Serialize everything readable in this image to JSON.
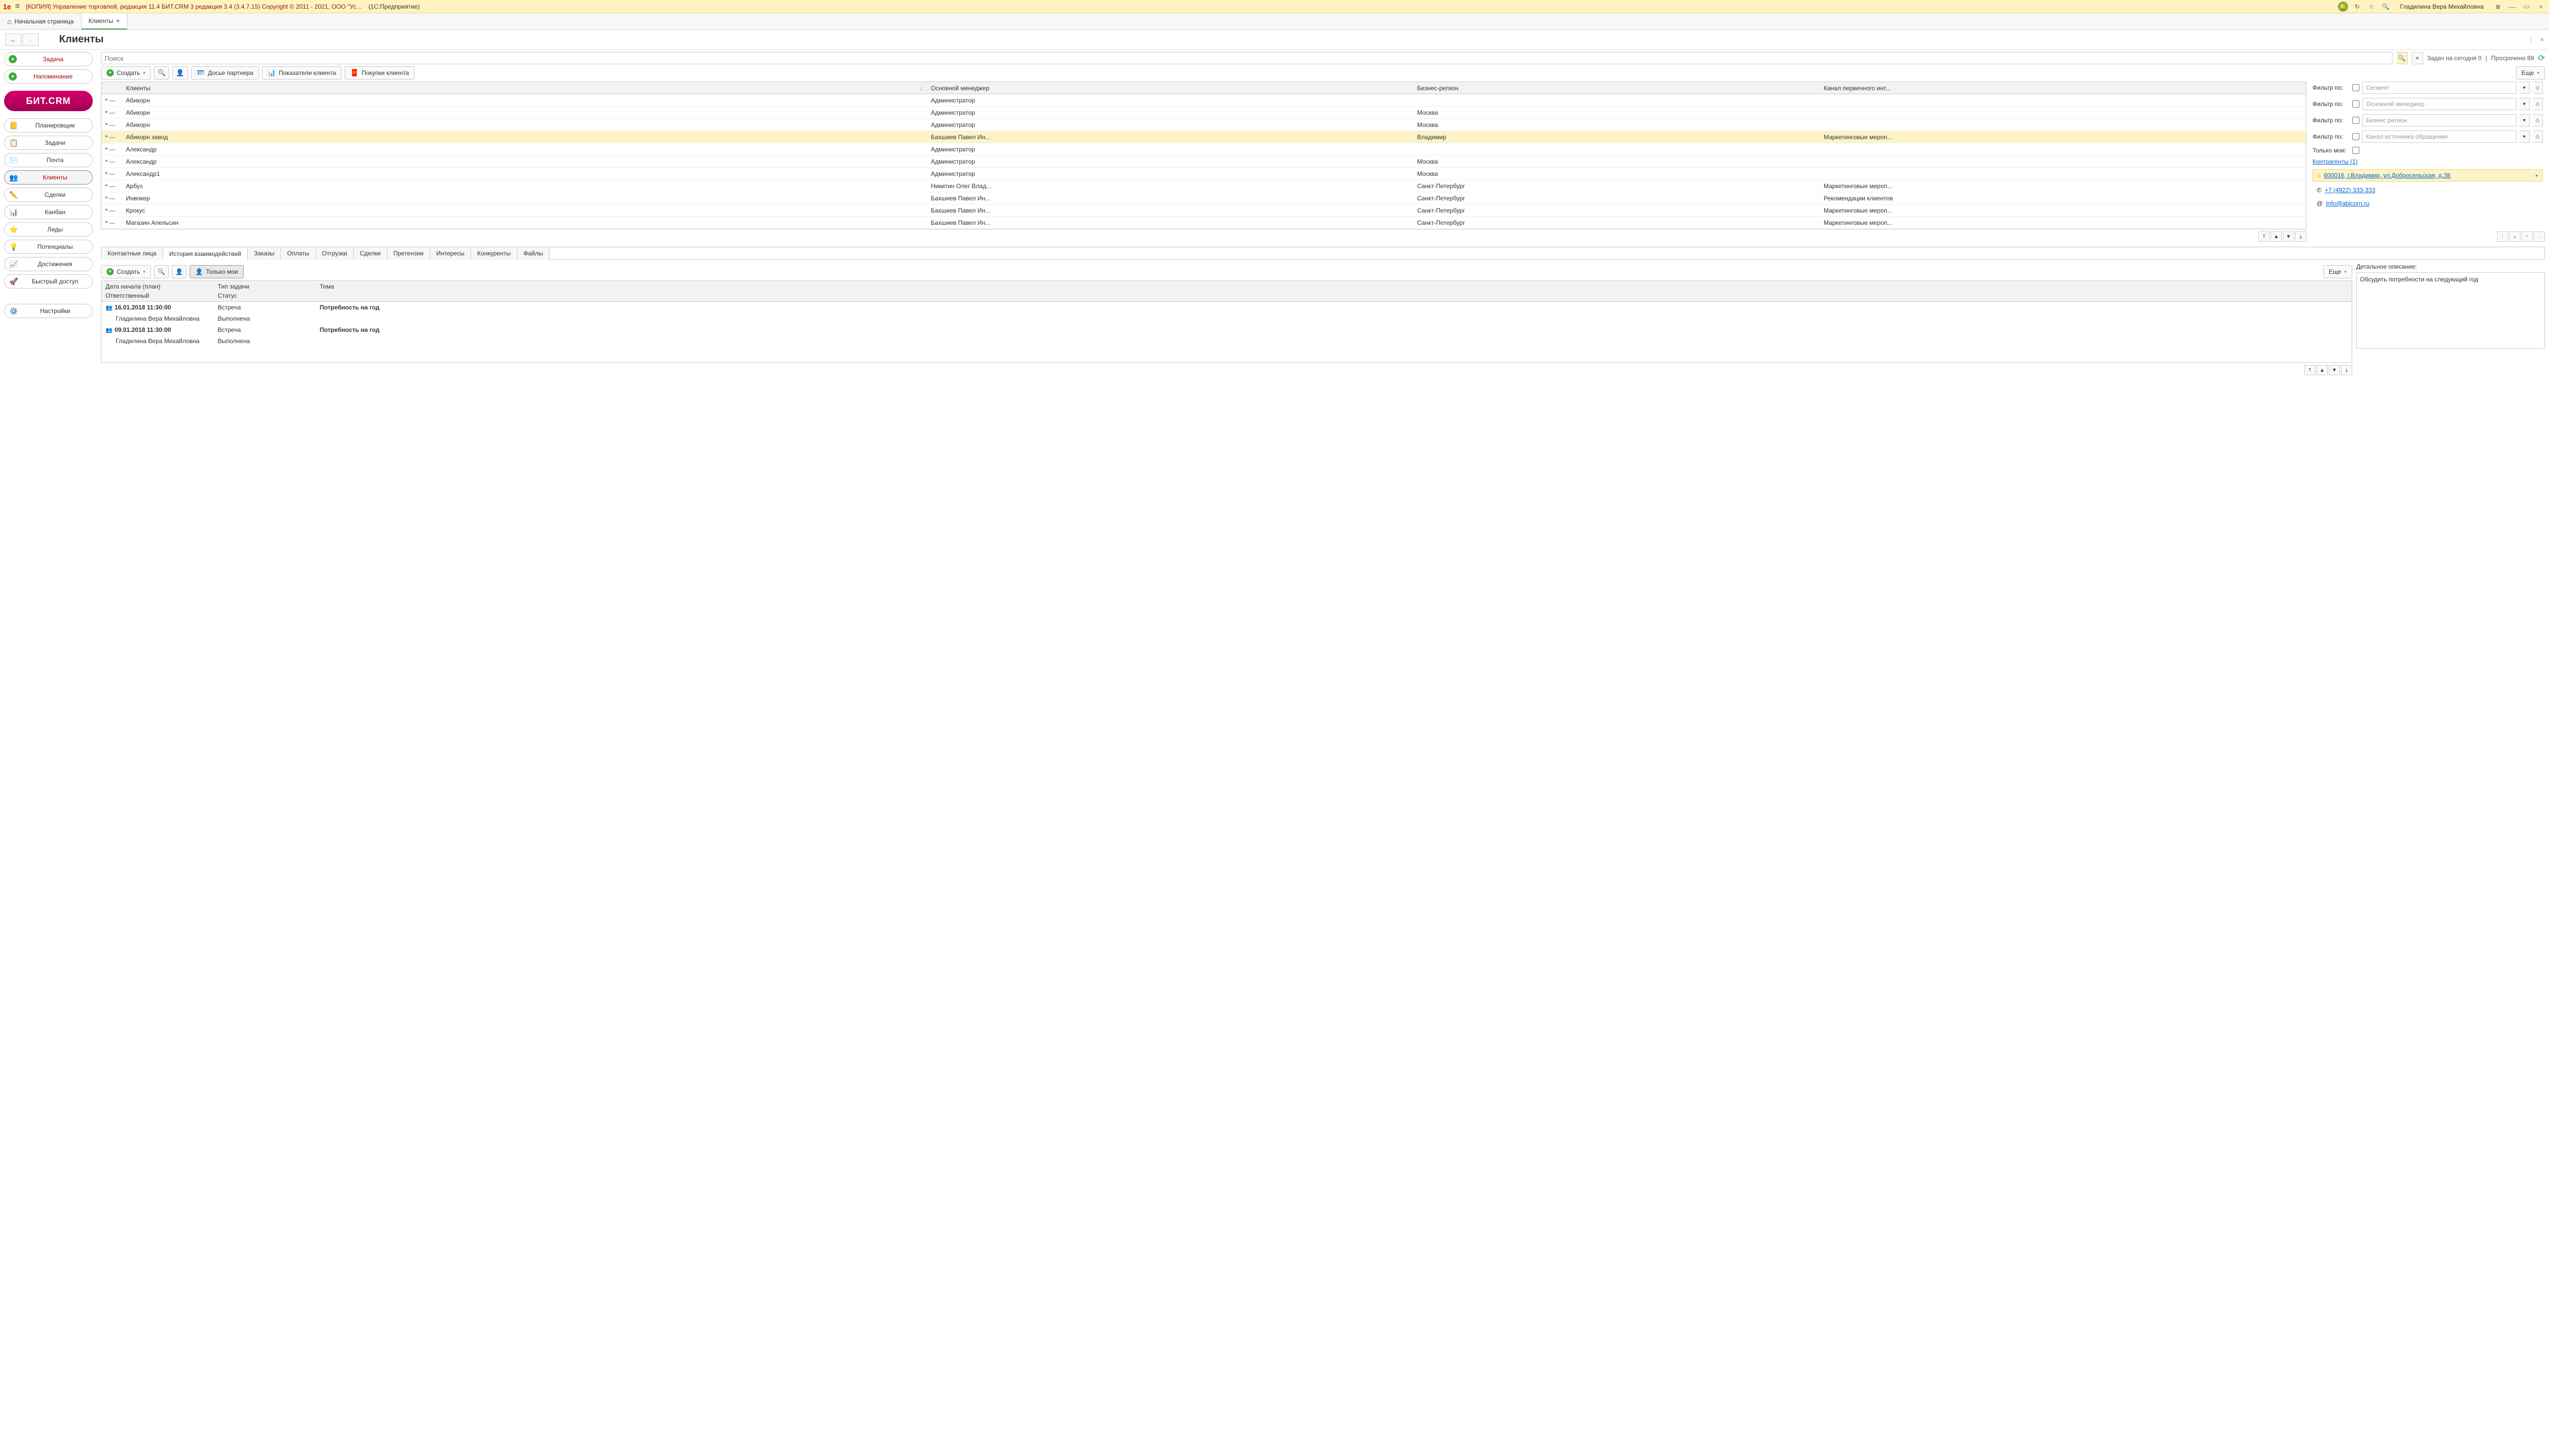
{
  "titlebar": {
    "title": "[КОПИЯ] Управление торговлей, редакция 11.4 БИТ.CRM 3 редакция 3.4 (3.4.7.15) Copyright © 2011 - 2021, ООО \"Ус...",
    "app": "(1С:Предприятие)",
    "user": "Гладилина Вера Михайловна"
  },
  "tabs": {
    "home": "Начальная страница",
    "active": "Клиенты"
  },
  "page": {
    "title": "Клиенты",
    "more": "⋮",
    "close": "×"
  },
  "search": {
    "placeholder": "Поиск",
    "stats1": "Задач на сегодня 0",
    "stats2": "Просрочено 89"
  },
  "sidebar": {
    "task": "Задача",
    "reminder": "Напоминание",
    "brand": "БИТ.CRM",
    "items": [
      {
        "icon": "📒",
        "label": "Планировщик"
      },
      {
        "icon": "📋",
        "label": "Задачи"
      },
      {
        "icon": "✉️",
        "label": "Почта"
      },
      {
        "icon": "👥",
        "label": "Клиенты",
        "active": true
      },
      {
        "icon": "✏️",
        "label": "Сделки"
      },
      {
        "icon": "📊",
        "label": "Канбан"
      },
      {
        "icon": "⭐",
        "label": "Лиды"
      },
      {
        "icon": "💡",
        "label": "Потенциалы"
      },
      {
        "icon": "📈",
        "label": "Достижения"
      },
      {
        "icon": "🚀",
        "label": "Быстрый доступ"
      }
    ],
    "settings": {
      "icon": "⚙️",
      "label": "Настройки"
    }
  },
  "toolbar": {
    "create": "Создать",
    "dossier": "Досье партнера",
    "indicators": "Показатели клиента",
    "purchases": "Покупки клиента",
    "more": "Еще"
  },
  "table": {
    "cols": {
      "name": "Клиенты",
      "mgr": "Основной менеджер",
      "region": "Бизнес-регион",
      "channel": "Канал первичного инт..."
    },
    "rows": [
      {
        "name": "Абикорн",
        "mgr": "Администратор",
        "region": "",
        "channel": ""
      },
      {
        "name": "Абикорн",
        "mgr": "Администратор",
        "region": "Москва",
        "channel": ""
      },
      {
        "name": "Абикорн",
        "mgr": "Администратор",
        "region": "Москва",
        "channel": ""
      },
      {
        "name": "Абикорн завод",
        "mgr": "Бахшиев Павел Ин...",
        "region": "Владимир",
        "channel": "Маркетинговые мероп...",
        "selected": true
      },
      {
        "name": "Александр",
        "mgr": "Администратор",
        "region": "",
        "channel": ""
      },
      {
        "name": "Александр",
        "mgr": "Администратор",
        "region": "Москва",
        "channel": ""
      },
      {
        "name": "Александр1",
        "mgr": "Администратор",
        "region": "Москва",
        "channel": ""
      },
      {
        "name": "Арбуз",
        "mgr": "Никитин Олег Влад...",
        "region": "Санкт-Петербург",
        "channel": "Маркетинговые мероп..."
      },
      {
        "name": "Инвокер",
        "mgr": "Бахшиев Павел Ин...",
        "region": "Санкт-Петербург",
        "channel": "Рекомендации клиентов"
      },
      {
        "name": "Крокус",
        "mgr": "Бахшиев Павел Ин...",
        "region": "Санкт-Петербург",
        "channel": "Маркетинговые мероп..."
      },
      {
        "name": "Магазин Апельсин",
        "mgr": "Бахшиев Павел Ин...",
        "region": "Санкт-Петербург",
        "channel": "Маркетинговые мероп..."
      }
    ]
  },
  "filters": {
    "label": "Фильтр по:",
    "segment": "Сегмент",
    "manager": "Основной менеджер",
    "region": "Бизнес регион",
    "channel": "Канал источника обращения",
    "mine": "Только мои:",
    "counterparties": "Контрагенты (1)",
    "address": "600016, г.Владимир, ул.Добросельская, д.38",
    "phone": "+7 (4922) 333-333",
    "email": "Info@abicorn.ru"
  },
  "subtabs": {
    "items": [
      "Контактные лица",
      "История взаимодействий",
      "Заказы",
      "Оплаты",
      "Отгрузки",
      "Сделки",
      "Претензии",
      "Интересы",
      "Конкуренты",
      "Файлы"
    ],
    "active": 1
  },
  "history": {
    "create": "Создать",
    "mine": "Только мои",
    "more": "Еще",
    "cols": {
      "date": "Дата начала (план)",
      "type": "Тип задачи",
      "topic": "Тема",
      "resp": "Ответственный",
      "status": "Статус"
    },
    "rows": [
      {
        "date": "16.01.2018 11:30:00",
        "type": "Встреча",
        "topic": "Потребность на год",
        "resp": "Гладилина Вера Михайловна",
        "status": "Выполнена"
      },
      {
        "date": "09.01.2018 11:30:00",
        "type": "Встреча",
        "topic": "Потребность на год",
        "resp": "Гладилина Вера Михайловна",
        "status": "Выполнена"
      }
    ],
    "detailLabel": "Детальное описание:",
    "detailText": "Обсудить потребности на следующий год"
  }
}
